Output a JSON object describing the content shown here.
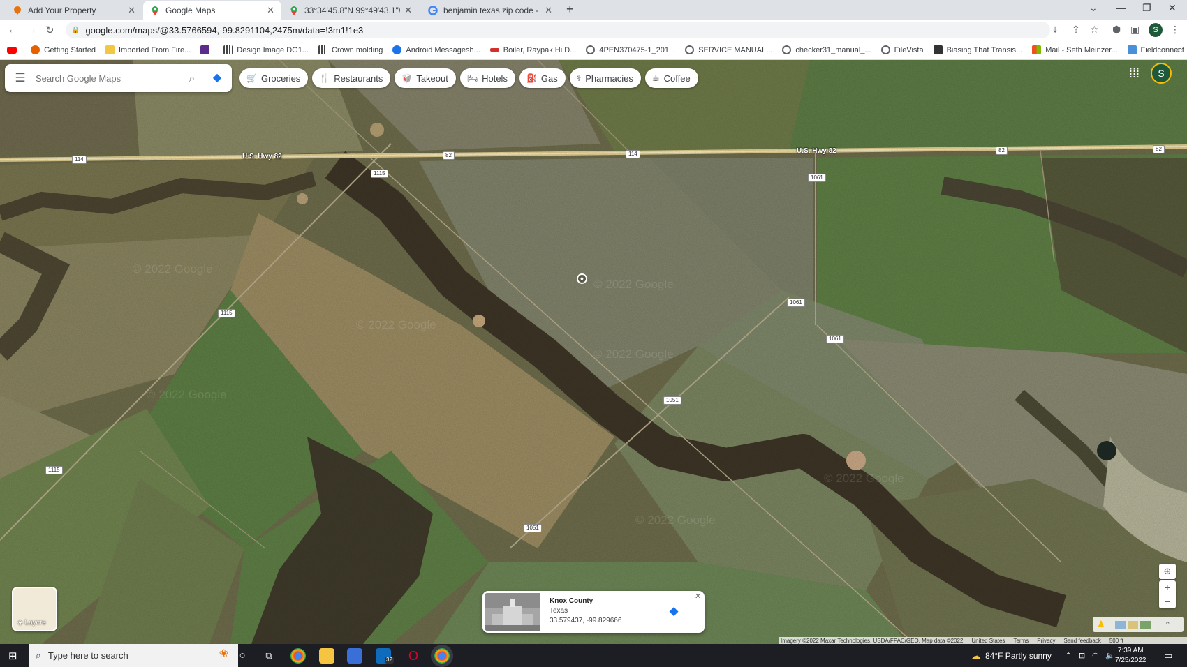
{
  "browser": {
    "tabs": [
      {
        "title": "Add Your Property",
        "active": false,
        "favicon": "orange-pin-icon"
      },
      {
        "title": "Google Maps",
        "active": true,
        "favicon": "maps-pin-icon"
      },
      {
        "title": "33°34'45.8\"N 99°49'43.1\"W - Goo",
        "active": false,
        "favicon": "maps-pin-icon"
      },
      {
        "title": "benjamin texas zip code - Googl",
        "active": false,
        "favicon": "google-g-icon"
      }
    ],
    "url": "google.com/maps/@33.5766594,-99.8291104,2475m/data=!3m1!1e3",
    "profile_initial": "S",
    "bookmarks": [
      {
        "label": "",
        "icon": "youtube-icon",
        "color": "#ff0000"
      },
      {
        "label": "Getting Started",
        "icon": "firefox-icon",
        "color": "#e66000"
      },
      {
        "label": "Imported From Fire...",
        "icon": "folder-icon",
        "color": "#f2c744"
      },
      {
        "label": "",
        "icon": "p-logo-icon",
        "color": "#5b2c8a"
      },
      {
        "label": "Design Image DG1...",
        "icon": "bars-icon",
        "color": "#444444"
      },
      {
        "label": "Crown molding",
        "icon": "bars-icon",
        "color": "#444444"
      },
      {
        "label": "Android Messagesh...",
        "icon": "messages-icon",
        "color": "#1a73e8"
      },
      {
        "label": "Boiler, Raypak Hi D...",
        "icon": "raypak-icon",
        "color": "#d32f2f"
      },
      {
        "label": "4PEN370475-1_201...",
        "icon": "globe-icon",
        "color": "#5f6368"
      },
      {
        "label": "SERVICE MANUAL...",
        "icon": "globe-icon",
        "color": "#5f6368"
      },
      {
        "label": "checker31_manual_...",
        "icon": "globe-icon",
        "color": "#5f6368"
      },
      {
        "label": "FileVista",
        "icon": "globe-icon",
        "color": "#5f6368"
      },
      {
        "label": "Biasing That Transis...",
        "icon": "biasing-icon",
        "color": "#333333"
      },
      {
        "label": "Mail - Seth Meinzer...",
        "icon": "microsoft-icon",
        "color": "#f25022"
      },
      {
        "label": "Fieldconnect",
        "icon": "doc-icon",
        "color": "#4a90d9"
      }
    ]
  },
  "map": {
    "search_placeholder": "Search Google Maps",
    "chips": [
      {
        "label": "Groceries",
        "icon": "cart-icon"
      },
      {
        "label": "Restaurants",
        "icon": "fork-knife-icon"
      },
      {
        "label": "Takeout",
        "icon": "takeout-icon"
      },
      {
        "label": "Hotels",
        "icon": "bed-icon"
      },
      {
        "label": "Gas",
        "icon": "gas-pump-icon"
      },
      {
        "label": "Pharmacies",
        "icon": "pharmacy-icon"
      },
      {
        "label": "Coffee",
        "icon": "coffee-cup-icon"
      }
    ],
    "account_initial": "S",
    "road_labels": [
      "U.S. Hwy 82",
      "U.S. Hwy 82"
    ],
    "shields": [
      "114",
      "82",
      "114",
      "82",
      "82",
      "1115",
      "1061",
      "1115",
      "1061",
      "1061",
      "1051",
      "1115",
      "1051"
    ],
    "layers_label": "Layers",
    "info_card": {
      "name": "Knox County",
      "region": "Texas",
      "coords": "33.579437, -99.829666"
    },
    "attribution": [
      "Imagery ©2022 Maxar Technologies, USDA/FPAC/GEO, Map data ©2022",
      "United States",
      "Terms",
      "Privacy",
      "Send feedback",
      "500 ft"
    ],
    "watermark": "© 2022 Google"
  },
  "taskbar": {
    "search_placeholder": "Type here to search",
    "weather": "84°F  Partly sunny",
    "time": "7:39 AM",
    "date": "7/25/2022",
    "mail_badge": "32"
  }
}
